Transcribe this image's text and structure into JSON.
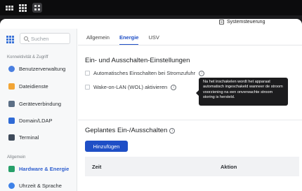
{
  "window": {
    "title": "Systemsteuerung"
  },
  "search": {
    "placeholder": "Suchen"
  },
  "sidebar": {
    "sections": [
      {
        "label": "Konnektivität & Zugriff",
        "items": [
          {
            "label": "Benutzerverwaltung",
            "icon": "users-icon"
          },
          {
            "label": "Dateidienste",
            "icon": "folder-icon"
          },
          {
            "label": "Geräteverbindung",
            "icon": "device-icon"
          },
          {
            "label": "Domain/LDAP",
            "icon": "domain-icon"
          },
          {
            "label": "Terminal",
            "icon": "terminal-icon"
          }
        ]
      },
      {
        "label": "Allgemein",
        "items": [
          {
            "label": "Hardware & Energie",
            "icon": "hardware-icon",
            "active": true
          },
          {
            "label": "Uhrzeit & Sprache",
            "icon": "clock-icon"
          }
        ]
      }
    ]
  },
  "tabs": [
    {
      "label": "Allgemein",
      "active": false
    },
    {
      "label": "Energie",
      "active": true
    },
    {
      "label": "USV",
      "active": false
    }
  ],
  "power_section": {
    "title": "Ein- und Ausschalten-Einstellungen",
    "auto_power_on": {
      "label": "Automatisches Einschalten bei Stromzufuhr",
      "checked": false
    },
    "wol": {
      "label": "Wake-on-LAN (WOL) aktivieren",
      "checked": false
    }
  },
  "tooltip": {
    "text": "Na het inschakelen wordt het apparaat automatisch ingeschakeld wanneer de stroom voorziening na een onverwachte stroom storing is hersteld."
  },
  "schedule_section": {
    "title": "Geplantes Ein-/Ausschalten",
    "add_button": "Hinzufügen",
    "columns": [
      "Zeit",
      "Aktion"
    ]
  },
  "colors": {
    "accent": "#1f4fc6",
    "tooltip_bg": "#1c1c1e",
    "sidebar_bg": "#f7f8f9"
  }
}
